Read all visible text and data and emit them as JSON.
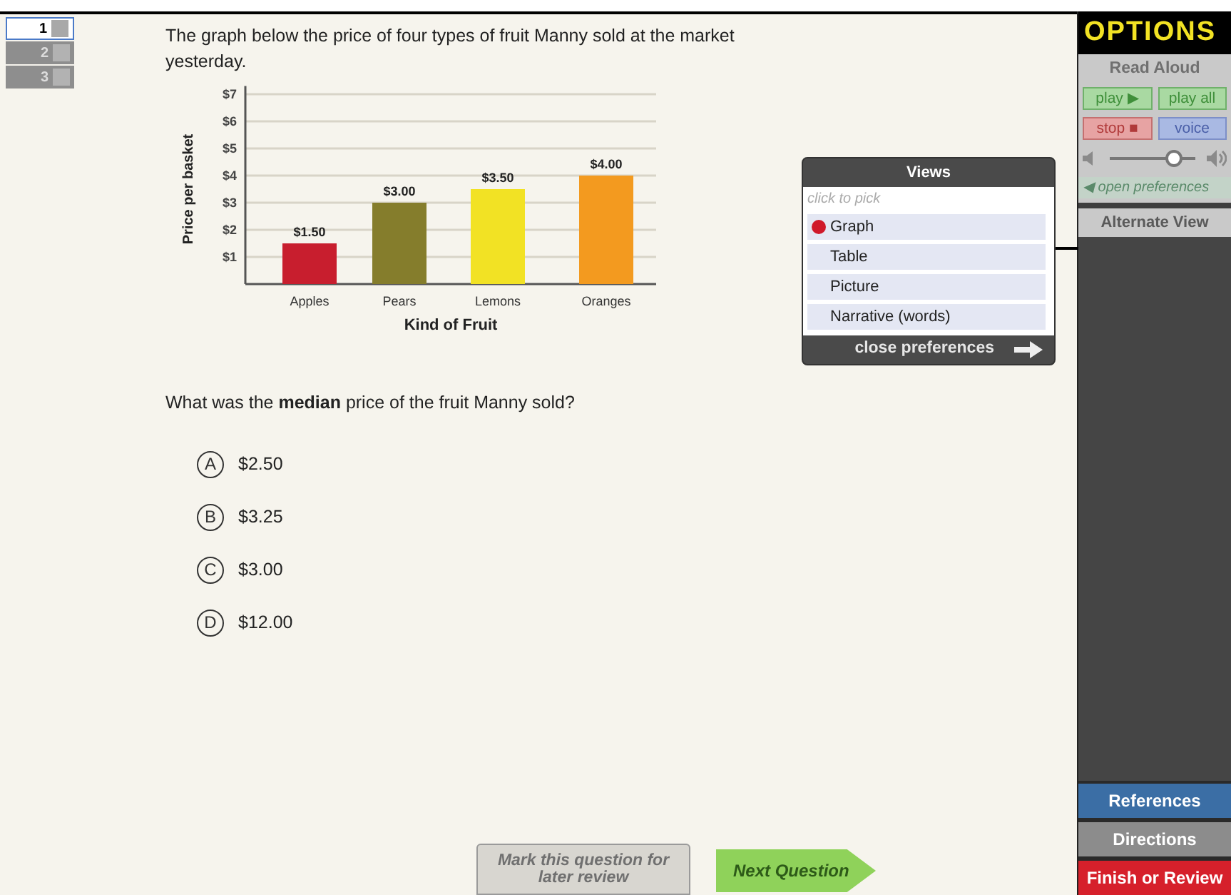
{
  "question_tabs": [
    {
      "label": "1",
      "selected": true
    },
    {
      "label": "2",
      "selected": false
    },
    {
      "label": "3",
      "selected": false
    }
  ],
  "question": {
    "prompt": "The graph below the price of four types of fruit Manny sold at the market yesterday.",
    "chart_data": {
      "type": "bar",
      "xlabel": "Kind of Fruit",
      "ylabel": "Price per basket",
      "series": [
        {
          "name": "Apples",
          "color": "#c81e2e",
          "values": [
            1.5,
            null,
            null,
            null
          ]
        },
        {
          "name": "Pears",
          "color": "#857d2c",
          "values": [
            null,
            3,
            null,
            null
          ]
        },
        {
          "name": "Lemons",
          "color": "#f2e224",
          "values": [
            null,
            null,
            3.5,
            null
          ]
        },
        {
          "name": "Oranges",
          "color": "#f39a1f",
          "values": [
            null,
            null,
            null,
            4
          ]
        }
      ],
      "grid": true,
      "ylim": [
        0,
        7
      ],
      "yticks": [
        {
          "value": 1,
          "label": "$1"
        },
        {
          "value": 2,
          "label": "$2"
        },
        {
          "value": 3,
          "label": "$3"
        },
        {
          "value": 4,
          "label": "$4"
        },
        {
          "value": 5,
          "label": "$5"
        },
        {
          "value": 6,
          "label": "$6"
        },
        {
          "value": 7,
          "label": "$7"
        }
      ],
      "value_labels": [
        "$1.50",
        "$3.00",
        "$3.50",
        "$4.00"
      ]
    },
    "ask": "What was the **median** price of the fruit Manny sold?",
    "choices": [
      {
        "letter": "A",
        "text": "$2.50"
      },
      {
        "letter": "B",
        "text": "$3.25"
      },
      {
        "letter": "C",
        "text": "$3.00"
      },
      {
        "letter": "D",
        "text": "$12.00"
      }
    ]
  },
  "views_popup": {
    "title": "Views",
    "hint": "click to pick",
    "items": [
      {
        "label": "Graph",
        "selected": true
      },
      {
        "label": "Table",
        "selected": false
      },
      {
        "label": "Picture",
        "selected": false
      },
      {
        "label": "Narrative (words)",
        "selected": false
      }
    ],
    "close": "close preferences"
  },
  "options": {
    "title": "OPTIONS",
    "read_aloud": {
      "title": "Read Aloud",
      "buttons": [
        {
          "label": "play ▶",
          "kind": "play"
        },
        {
          "label": "play all",
          "kind": "play"
        },
        {
          "label": "stop ■",
          "kind": "stop"
        },
        {
          "label": "voice",
          "kind": "voice"
        }
      ],
      "volume": {
        "level": 0.75
      },
      "open_preferences": "◀ open preferences"
    },
    "alternate_view": "Alternate View",
    "bottom_buttons": [
      {
        "label": "References",
        "kind": "blue"
      },
      {
        "label": "Directions",
        "kind": "gray"
      },
      {
        "label": "Finish or Review",
        "kind": "red"
      }
    ]
  },
  "footer": {
    "mark": "Mark this question for later review",
    "next": "Next Question"
  }
}
